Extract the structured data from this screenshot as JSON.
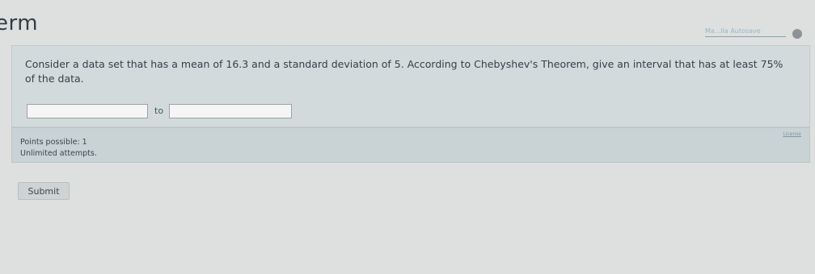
{
  "header": {
    "title": "erm",
    "top_link": "Ma...lla Autosave"
  },
  "question": {
    "text": "Consider a data set that has a mean of 16.3 and a standard deviation of 5. According to Chebyshev's Theorem, give an interval that has at least 75% of the data.",
    "answer_low": {
      "value": "",
      "placeholder": ""
    },
    "to_label": "to",
    "answer_high": {
      "value": "",
      "placeholder": ""
    }
  },
  "meta": {
    "license_label": "License",
    "points": "Points possible: 1",
    "attempts": "Unlimited attempts."
  },
  "actions": {
    "submit_label": "Submit"
  }
}
